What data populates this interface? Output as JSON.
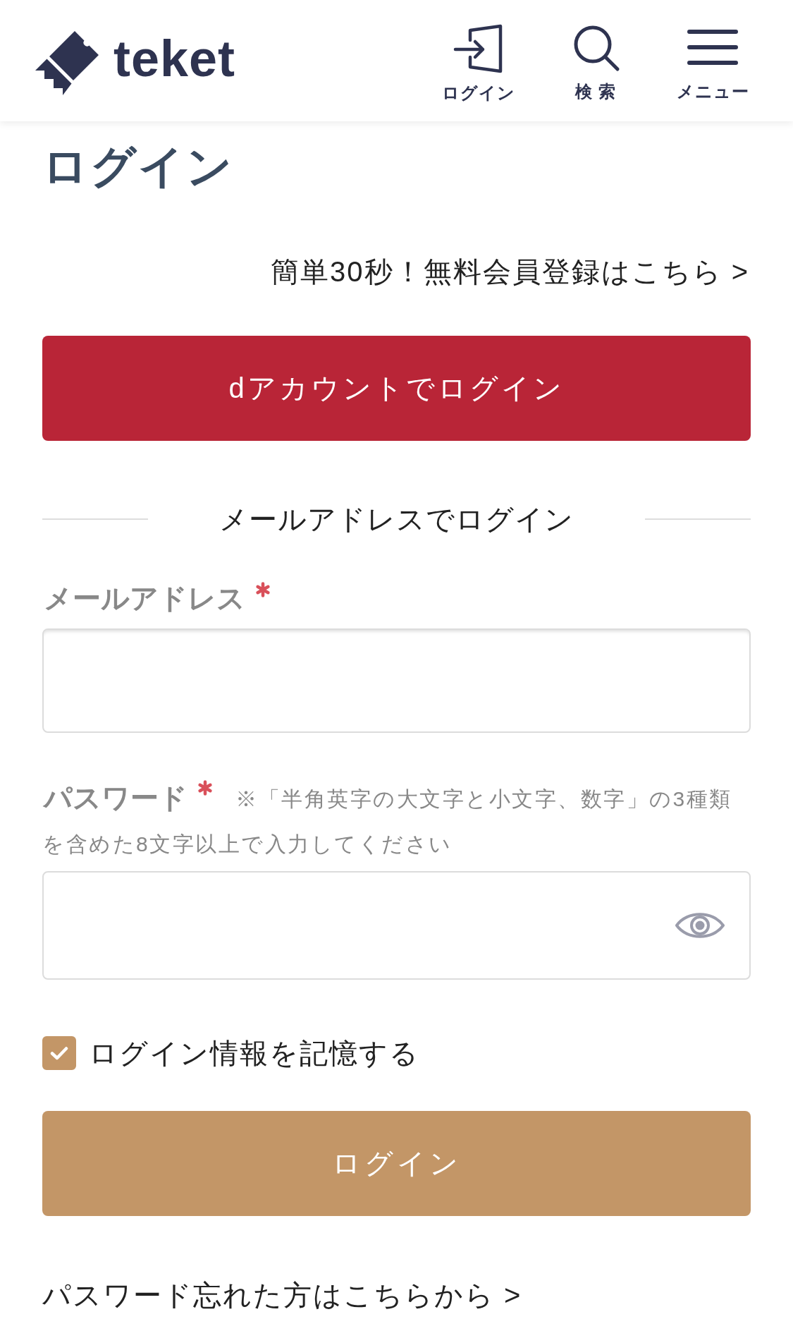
{
  "header": {
    "logo_text": "teket",
    "nav": [
      {
        "kind": "login",
        "label": "ログイン"
      },
      {
        "kind": "search",
        "label": "検 索"
      },
      {
        "kind": "menu",
        "label": "メニュー"
      }
    ]
  },
  "page_title": "ログイン",
  "signup_link": "簡単30秒！無料会員登録はこちら >",
  "d_account_button": "dアカウントでログイン",
  "divider_label": "メールアドレスでログイン",
  "fields": [
    {
      "kind": "email",
      "label": "メールアドレス",
      "required": true
    },
    {
      "kind": "password",
      "label": "パスワード",
      "required": true,
      "hint_lines": [
        "※「半角英字の大文字と小文字、数字」の3種類",
        "を含めた8文字以上で入力してください"
      ],
      "reveal_toggle": true
    }
  ],
  "remember": {
    "label": "ログイン情報を記憶する",
    "checked": true
  },
  "login_button": "ログイン",
  "forgot_link": "パスワード忘れた方はこちらから >"
}
